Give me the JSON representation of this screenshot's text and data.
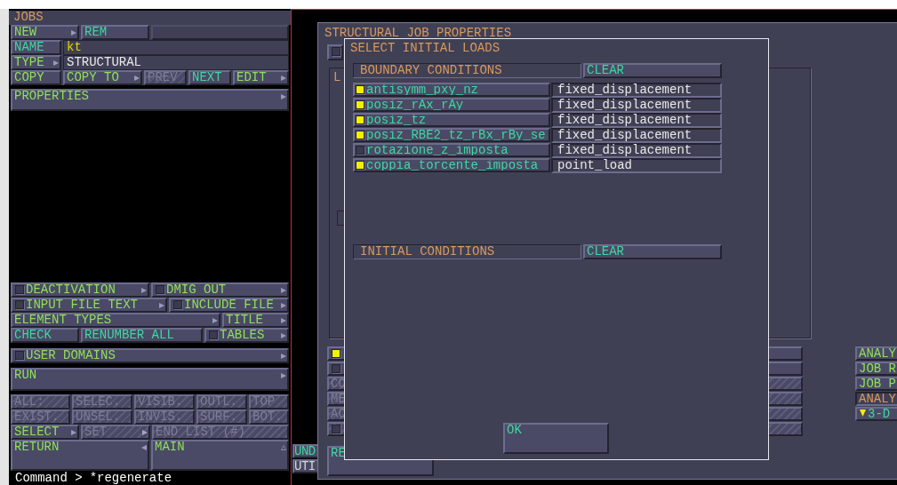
{
  "jobs_panel": {
    "title": "JOBS",
    "groups": [
      {
        "rows": [
          {
            "buttons": [
              {
                "kind": "menu",
                "label": "NEW",
                "arrow": "▸"
              },
              {
                "kind": "action",
                "label": "REM"
              },
              {
                "kind": "blank"
              }
            ]
          },
          {
            "buttons": [
              {
                "kind": "action",
                "label": "NAME"
              },
              {
                "kind": "field",
                "value": "kt",
                "editable": true
              }
            ]
          },
          {
            "buttons": [
              {
                "kind": "menu",
                "label": "TYPE",
                "arrow": "▸"
              },
              {
                "kind": "field",
                "value": "STRUCTURAL",
                "editable": false
              }
            ]
          },
          {
            "buttons": [
              {
                "kind": "menu",
                "label": "COPY"
              },
              {
                "kind": "menu",
                "label": "COPY TO",
                "arrow": "▸"
              },
              {
                "kind": "disabled",
                "label": "PREV"
              },
              {
                "kind": "action",
                "label": "NEXT"
              },
              {
                "kind": "menu",
                "label": "EDIT",
                "arrow": "▸"
              }
            ]
          }
        ]
      },
      {
        "rows": [
          {
            "buttons": [
              {
                "kind": "menu",
                "label": "PROPERTIES",
                "arrow": "▸"
              }
            ]
          }
        ]
      },
      {
        "rows": [
          {
            "buttons": [
              {
                "kind": "menu",
                "label": "DEACTIVATION",
                "arrow": "▸",
                "checkbox": true,
                "checked": false
              },
              {
                "kind": "menu",
                "label": "DMIG OUT",
                "arrow": "▸",
                "checkbox": true,
                "checked": false
              }
            ]
          },
          {
            "buttons": [
              {
                "kind": "menu",
                "label": "INPUT FILE TEXT",
                "arrow": "▸",
                "checkbox": true,
                "checked": false
              },
              {
                "kind": "menu",
                "label": "INCLUDE FILE",
                "arrow": "▸",
                "checkbox": true,
                "checked": false
              }
            ]
          },
          {
            "buttons": [
              {
                "kind": "menu",
                "label": "ELEMENT TYPES",
                "arrow": "▸"
              },
              {
                "kind": "menu",
                "label": "TITLE",
                "arrow": "▸"
              }
            ]
          },
          {
            "buttons": [
              {
                "kind": "action",
                "label": "CHECK"
              },
              {
                "kind": "action",
                "label": "RENUMBER ALL"
              },
              {
                "kind": "menu",
                "label": "TABLES",
                "arrow": "▸",
                "checkbox": true,
                "checked": false
              }
            ]
          }
        ]
      },
      {
        "rows": [
          {
            "buttons": [
              {
                "kind": "menu",
                "label": "USER DOMAINS",
                "arrow": "▸",
                "checkbox": true,
                "checked": false
              }
            ]
          }
        ]
      },
      {
        "rows": [
          {
            "buttons": [
              {
                "kind": "menu",
                "label": "RUN",
                "arrow": "▸"
              }
            ]
          }
        ]
      },
      {
        "rows": [
          {
            "buttons": [
              {
                "kind": "disabled",
                "label": "ALL:"
              },
              {
                "kind": "disabled",
                "label": "SELEC."
              },
              {
                "kind": "disabled",
                "label": "VISIB."
              },
              {
                "kind": "disabled",
                "label": "OUTL."
              },
              {
                "kind": "disabled",
                "label": "TOP"
              }
            ]
          },
          {
            "buttons": [
              {
                "kind": "disabled",
                "label": "EXIST."
              },
              {
                "kind": "disabled",
                "label": "UNSEL."
              },
              {
                "kind": "disabled",
                "label": "INVIS."
              },
              {
                "kind": "disabled",
                "label": "SURF."
              },
              {
                "kind": "disabled",
                "label": "BOT."
              }
            ]
          },
          {
            "buttons": [
              {
                "kind": "menu",
                "label": "SELECT",
                "arrow": "▸"
              },
              {
                "kind": "disabled",
                "label": "SET",
                "arrow": "▸"
              },
              {
                "kind": "disabled",
                "label": "END LIST (#)"
              }
            ]
          }
        ]
      },
      {
        "rows": [
          {
            "buttons": [
              {
                "kind": "menu",
                "label": "RETURN",
                "arrow": "◂"
              },
              {
                "kind": "menu",
                "label": "MAIN",
                "arrow": "▵"
              }
            ]
          }
        ]
      }
    ]
  },
  "command_line": {
    "prompt": "Command >",
    "text": "*regenerate"
  },
  "background_window": {
    "buttons": [
      {
        "kind": "action",
        "label": "UND"
      },
      {
        "kind": "plain",
        "label": "UTI"
      }
    ]
  },
  "job_window": {
    "title": "STRUCTURAL JOB PROPERTIES",
    "top_checkbox": {
      "checked": false
    },
    "group_label": "L",
    "rows": [
      {
        "kind": "menu",
        "checkbox": true,
        "checked": true
      },
      {
        "kind": "menu",
        "checkbox": true,
        "checked": false
      },
      {
        "kind": "disabled",
        "label": "CO"
      },
      {
        "kind": "disabled",
        "label": "ME"
      },
      {
        "kind": "disabled",
        "label": "AC"
      },
      {
        "kind": "disabled",
        "checkbox": true,
        "checked": false
      }
    ],
    "side_buttons": [
      {
        "kind": "menu",
        "label": "ANALY",
        "selected": false
      },
      {
        "kind": "menu",
        "label": "JOB R",
        "selected": false
      },
      {
        "kind": "menu",
        "label": "JOB P",
        "selected": false
      },
      {
        "kind": "menu",
        "label": "ANALY",
        "selected": true
      },
      {
        "kind": "action",
        "label": "3-D",
        "selected": false
      }
    ],
    "bottom_button": "RE"
  },
  "dialog": {
    "title": "SELECT INITIAL LOADS",
    "sections": [
      {
        "header": "BOUNDARY CONDITIONS",
        "clear": "CLEAR",
        "loads": [
          {
            "name": "antisymm_pxy_nz",
            "checked": true,
            "type": "fixed_displacement"
          },
          {
            "name": "posiz_rAx_rAy",
            "checked": true,
            "type": "fixed_displacement"
          },
          {
            "name": "posiz_tz",
            "checked": true,
            "type": "fixed_displacement"
          },
          {
            "name": "posiz_RBE2_tz_rBx_rBy_se",
            "checked": true,
            "type": "fixed_displacement"
          },
          {
            "name": "rotazione_z_imposta",
            "checked": false,
            "type": "fixed_displacement"
          },
          {
            "name": "coppia_torcente_imposta",
            "checked": true,
            "type": "point_load"
          }
        ]
      },
      {
        "header": "INITIAL CONDITIONS",
        "clear": "CLEAR"
      }
    ],
    "ok": "OK"
  }
}
